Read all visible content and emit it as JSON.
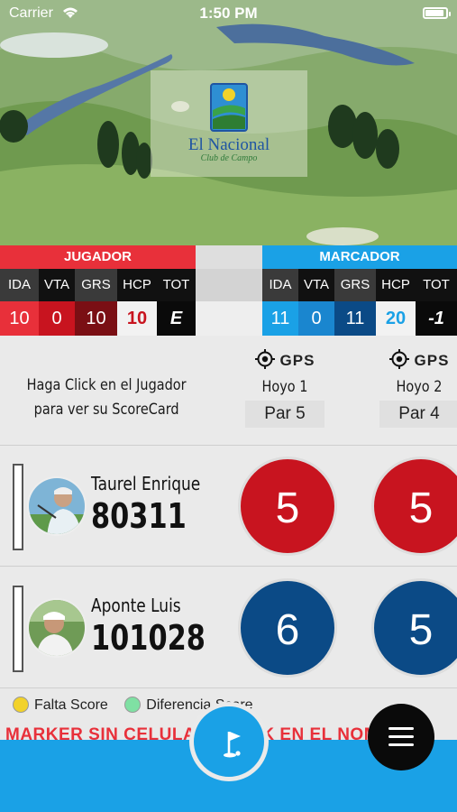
{
  "status_bar": {
    "carrier": "Carrier",
    "time": "1:50 PM"
  },
  "logo": {
    "name": "El Nacional",
    "subtitle": "Club de Campo"
  },
  "jugador": {
    "title": "JUGADOR",
    "labels": [
      "IDA",
      "VTA",
      "GRS",
      "HCP",
      "TOT"
    ],
    "values": [
      "10",
      "0",
      "10",
      "10",
      "E"
    ]
  },
  "marcador": {
    "title": "MARCADOR",
    "labels": [
      "IDA",
      "VTA",
      "GRS",
      "HCP",
      "TOT"
    ],
    "values": [
      "11",
      "0",
      "11",
      "20",
      "-1"
    ]
  },
  "hint": {
    "line1": "Haga Click en el Jugador",
    "line2": "para ver su ScoreCard"
  },
  "holes": [
    {
      "gps": "GPS",
      "label": "Hoyo 1",
      "par": "Par 5"
    },
    {
      "gps": "GPS",
      "label": "Hoyo 2",
      "par": "Par 4"
    }
  ],
  "players": [
    {
      "name": "Taurel Enrique",
      "id": "80311",
      "scores": [
        "5",
        "5"
      ]
    },
    {
      "name": "Aponte Luis",
      "id": "101028",
      "scores": [
        "6",
        "5"
      ]
    }
  ],
  "legend": {
    "item1": "Falta Score",
    "item2": "Diferencia Score"
  },
  "marquee": "MARKER SIN CELULAR: CLICK EN EL NOMBRE",
  "colors": {
    "red": "#e8303a",
    "blue": "#1aa1e6",
    "score_red": "#c8141f",
    "score_blue": "#0b4a86"
  },
  "icons": {
    "gps": "crosshair-icon",
    "golf": "golf-flag-icon",
    "menu": "hamburger-menu-icon"
  }
}
